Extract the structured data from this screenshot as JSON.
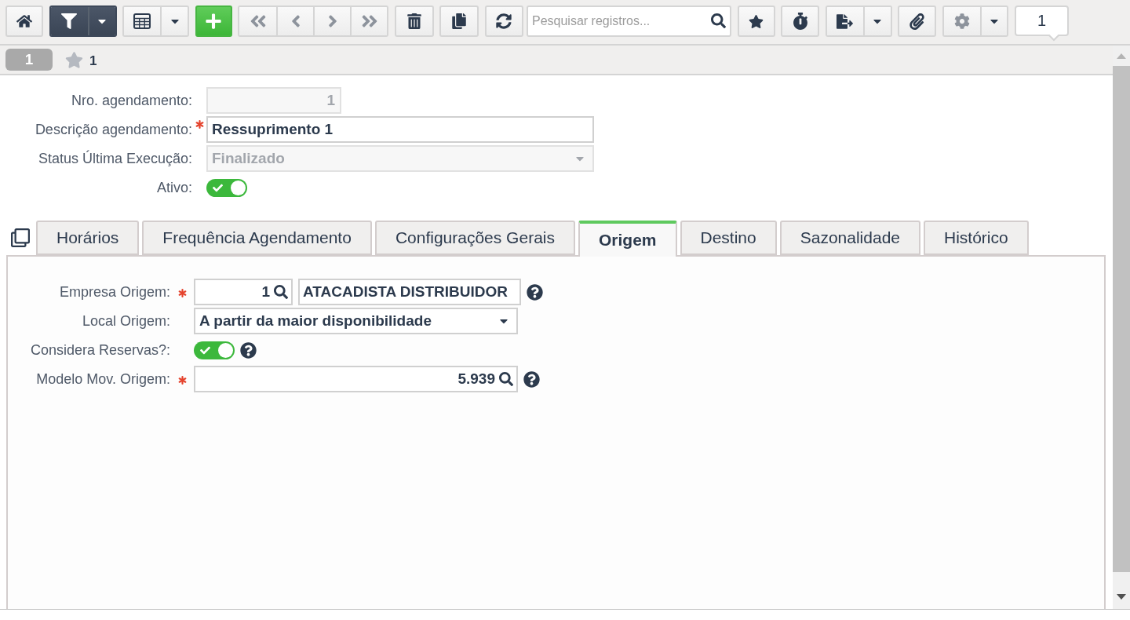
{
  "toolbar": {
    "filter_on": true,
    "navigation_disabled": true,
    "search": {
      "placeholder": "Pesquisar registros..."
    },
    "record_counter": "1"
  },
  "record_bar": {
    "record_tab": "1",
    "favorites_count": "1"
  },
  "header_form": {
    "fields": [
      {
        "kind": "number",
        "label": "Nro. agendamento:",
        "value": "1",
        "required": false,
        "disabled": true
      },
      {
        "kind": "text",
        "label": "Descrição agendamento:",
        "value": "Ressuprimento 1",
        "required": true,
        "disabled": false
      },
      {
        "kind": "select",
        "label": "Status Última Execução:",
        "value": "Finalizado",
        "required": false,
        "disabled": true
      },
      {
        "kind": "toggle",
        "label": "Ativo:",
        "required": false,
        "on": true
      }
    ]
  },
  "tabs": [
    {
      "label": "Horários",
      "selected": false
    },
    {
      "label": "Frequência Agendamento",
      "selected": false
    },
    {
      "label": "Configurações Gerais",
      "selected": false
    },
    {
      "label": "Origem",
      "selected": true
    },
    {
      "label": "Destino",
      "selected": false
    },
    {
      "label": "Sazonalidade",
      "selected": false
    },
    {
      "label": "Histórico",
      "selected": false
    }
  ],
  "tab_panel": {
    "fields": [
      {
        "kind": "lookup",
        "label": "Empresa Origem:",
        "required": true,
        "code": "1",
        "description": "ATACADISTA DISTRIBUIDOR",
        "help": true
      },
      {
        "kind": "select",
        "label": "Local Origem:",
        "required": false,
        "value": "A partir da maior disponibilidade",
        "disabled": false,
        "help": false
      },
      {
        "kind": "toggle",
        "label": "Considera Reservas?:",
        "required": false,
        "on": true,
        "help": true
      },
      {
        "kind": "lookup",
        "label": "Modelo Mov. Origem:",
        "required": true,
        "code": "5.939",
        "help": true
      }
    ]
  }
}
